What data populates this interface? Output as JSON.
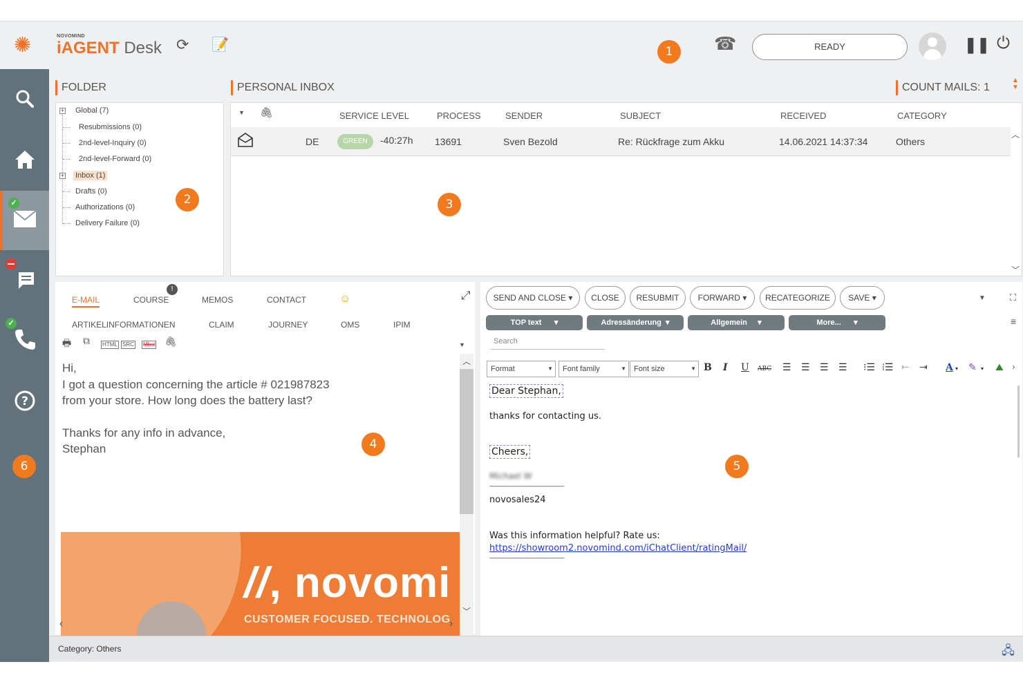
{
  "header": {
    "brand_small": "novomind",
    "brand_main": "iAGENT",
    "brand_sub": "Desk",
    "status_label": "READY",
    "callouts": [
      "1",
      "2",
      "3",
      "4",
      "5",
      "6"
    ]
  },
  "sidebar": {
    "items": [
      {
        "name": "search",
        "icon": "search-icon"
      },
      {
        "name": "home",
        "icon": "home-icon"
      },
      {
        "name": "mail",
        "icon": "mail-icon",
        "active": true,
        "status": "ok"
      },
      {
        "name": "chat",
        "icon": "chat-icon",
        "status": "blocked"
      },
      {
        "name": "phone",
        "icon": "phone-icon",
        "status": "ok"
      },
      {
        "name": "help",
        "icon": "help-icon"
      }
    ]
  },
  "folder": {
    "title": "FOLDER",
    "items": [
      "Global (7)",
      "Resubmissions (0)",
      "2nd-level-Inquiry (0)",
      "2nd-level-Forward (0)",
      "Inbox (1)",
      "Drafts (0)",
      "Authorizations (0)",
      "Delivery Failure (0)"
    ]
  },
  "inbox": {
    "title": "PERSONAL INBOX",
    "count_label": "COUNT MAILS: 1",
    "columns": [
      "SERVICE LEVEL",
      "PROCESS",
      "SENDER",
      "SUBJECT",
      "RECEIVED",
      "CATEGORY"
    ],
    "rows": [
      {
        "language": "DE",
        "service_level": "GREEN",
        "time": "-40:27h",
        "process": "13691",
        "sender": "Sven Bezold",
        "subject": "Re: Rückfrage zum Akku",
        "received": "14.06.2021 14:37:34",
        "category": "Others"
      }
    ]
  },
  "mail_view": {
    "tabs_row1": [
      "E-MAIL",
      "COURSE",
      "MEMOS",
      "CONTACT"
    ],
    "tabs_row2": [
      "ARTIKELINFORMATIONEN",
      "CLAIM",
      "JOURNEY",
      "OMS",
      "IPIM"
    ],
    "course_badge": "!",
    "tool_tags": [
      "HTML",
      "SRC",
      "Mbst"
    ],
    "body_lines": [
      "Hi,",
      "I got a question concerning the article # 021987823",
      "from your store. How long does the battery last?",
      "",
      "Thanks for any info in advance,",
      "Stephan"
    ],
    "banner_logo": "novomi",
    "banner_tagline": "CUSTOMER FOCUSED. TECHNOLOG"
  },
  "reply": {
    "buttons": [
      "SEND AND CLOSE",
      "CLOSE",
      "RESUBMIT",
      "FORWARD",
      "RECATEGORIZE",
      "SAVE"
    ],
    "templates": [
      "TOP text",
      "Adressänderung",
      "Allgemein",
      "More..."
    ],
    "search_placeholder": "Search",
    "format_select": "Format",
    "font_family_select": "Font family",
    "font_size_select": "Font size",
    "lines": {
      "greeting": "Dear Stephan,",
      "body": "thanks for contacting us.",
      "closing": "Cheers,",
      "signature_name": "Michael W",
      "separator": "------------------------------------------------",
      "company": "novosales24",
      "rating_q": "Was this information helpful? Rate us:",
      "rating_link": "https://showroom2.novomind.com/iChatClient/ratingMail/",
      "separator2": "------------------------------------------------"
    }
  },
  "status_bar": {
    "category": "Category: Others"
  },
  "colors": {
    "accent": "#f07226",
    "sidebar": "#62727b",
    "callout": "#f27a1e",
    "service_green": "#b7d6a8"
  }
}
